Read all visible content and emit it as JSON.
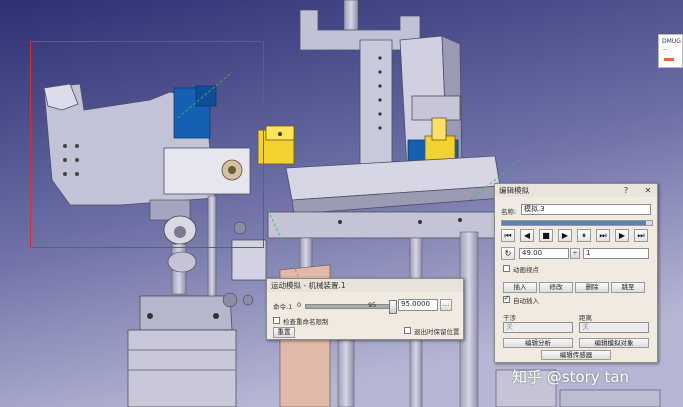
{
  "viewport": {
    "label": "CATIA 3D viewport - mechanism model",
    "colors": {
      "bg_top": "#2d2f72",
      "bg_bottom": "#b6b6d4",
      "part_gray": "#bcbcd2",
      "part_dark": "#8a8aa6",
      "accent_blue": "#1660b4",
      "accent_yellow": "#f2d22e",
      "highlight_red": "#d43030"
    }
  },
  "side_tab": {
    "text": "DMUG",
    "sub": "..."
  },
  "simulation_dialog": {
    "title": "运动模拟 - 机械装置.1",
    "command_label": "命令.1",
    "slider_min": "0",
    "slider_marker": "95",
    "value": "95.0000",
    "check_interference_label": "检查重命名限制",
    "reset_button": "重置",
    "keep_position_label": "退出时保留位置",
    "slider_level_percent": 95
  },
  "edit_sim_dialog": {
    "title": "编辑模拟",
    "name_label": "名称:",
    "name_value": "模拟.3",
    "player_buttons": [
      "⏮",
      "◀",
      "■",
      "▶",
      "⏸",
      "⏭",
      "▶",
      "⏭"
    ],
    "step_value": "49.00",
    "step_select": "1",
    "animate_label": "动画视点",
    "insert_button": "插入",
    "modify_button": "修改",
    "delete_button": "删除",
    "jump_button": "跳至",
    "auto_insert_label": "自动插入",
    "interference_label": "干涉",
    "distance_label": "距离",
    "interference_value": "关",
    "distance_value": "关",
    "edit_analysis_button": "编辑分析",
    "edit_sim_objects_button": "编辑模拟对象",
    "edit_sensors_button": "编辑传感器",
    "progress_percent": 96
  },
  "watermark": "知乎 @story tan"
}
